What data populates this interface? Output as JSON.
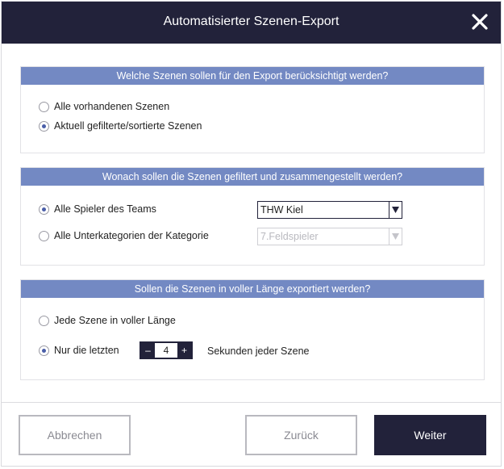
{
  "dialog": {
    "title": "Automatisierter Szenen-Export",
    "close_icon": "close-icon"
  },
  "section1": {
    "header": "Welche Szenen sollen für den Export berücksichtigt werden?",
    "options": [
      {
        "label": "Alle vorhandenen Szenen",
        "checked": false
      },
      {
        "label": "Aktuell gefilterte/sortierte Szenen",
        "checked": true
      }
    ]
  },
  "section2": {
    "header": "Wonach sollen die Szenen gefiltert und zusammengestellt werden?",
    "options": [
      {
        "label": "Alle Spieler des Teams",
        "checked": true,
        "select_value": "THW Kiel",
        "enabled": true
      },
      {
        "label": "Alle Unterkategorien der Kategorie",
        "checked": false,
        "select_value": "7.Feldspieler",
        "enabled": false
      }
    ]
  },
  "section3": {
    "header": "Sollen die Szenen in voller Länge exportiert werden?",
    "options": [
      {
        "label": "Jede Szene in voller Länge",
        "checked": false
      },
      {
        "label": "Nur die letzten",
        "checked": true
      }
    ],
    "stepper": {
      "minus": "–",
      "value": "4",
      "plus": "+"
    },
    "suffix": "Sekunden jeder Szene"
  },
  "footer": {
    "cancel_label": "Abbrechen",
    "back_label": "Zurück",
    "next_label": "Weiter"
  },
  "colors": {
    "primary": "#22223a",
    "section_header": "#7389c3",
    "radio_dot": "#4a5ea8"
  }
}
